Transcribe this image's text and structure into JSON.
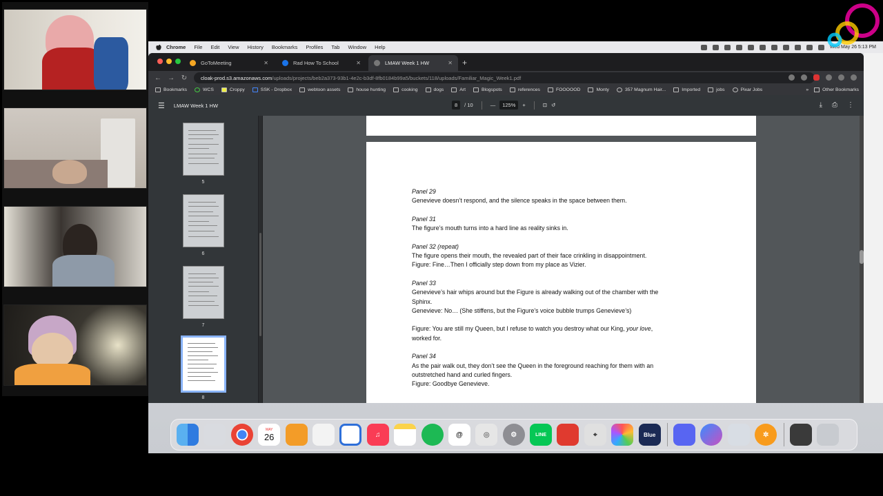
{
  "menubar": {
    "items": [
      "Chrome",
      "File",
      "Edit",
      "View",
      "History",
      "Bookmarks",
      "Profiles",
      "Tab",
      "Window",
      "Help"
    ],
    "clock": "Wed May 26  5:13 PM"
  },
  "tabs": [
    {
      "label": "GoToMeeting",
      "color": "#f5a623"
    },
    {
      "label": "Rad How To School",
      "color": "#1a73e8"
    },
    {
      "label": "LMAW Week 1 HW",
      "color": "#777777"
    }
  ],
  "address": {
    "host": "cloak-prod.s3.amazonaws.com",
    "path": "/uploads/projects/beb2a373-93b1-4e2c-b3df-8fb0184b99a5/buckets/118/uploads/Familiar_Magic_Week1.pdf"
  },
  "bookmarks": [
    "Bookmarks",
    "WCS",
    "Croppy",
    "SSK - Dropbox",
    "webtoon assets",
    "house hunting",
    "cooking",
    "dogs",
    "Art",
    "Blogspots",
    "references",
    "FOOOOOD",
    "Monty",
    "357 Magnum Hair...",
    "Imported",
    "jobs",
    "Pixar Jobs"
  ],
  "other_bookmarks": "Other Bookmarks",
  "pdf": {
    "title": "LMAW Week 1 HW",
    "page": "8",
    "total": "/  10",
    "zoom": "125%",
    "thumb_labels": [
      "5",
      "6",
      "7",
      "8"
    ]
  },
  "script": {
    "p29_h": "Panel 29",
    "p29_1": "Genevieve doesn’t respond, and the silence speaks in the space between them.",
    "p31_h": "Panel 31",
    "p31_1": "The figure’s mouth turns into a hard line as reality sinks in.",
    "p32_h": "Panel 32 (repeat)",
    "p32_1": "The figure opens their mouth, the revealed part of their face crinkling in disappointment.",
    "p32_2": "Figure: Fine…Then I officially step down from my place as Vizier.",
    "p33_h": "Panel 33",
    "p33_1": "Genevieve’s hair whips around but the Figure is already walking out of the chamber with the",
    "p33_2": "Sphinx.",
    "p33_3": "Genevieve: No… (She stiffens, but the Figure’s voice bubble trumps Genevieve’s)",
    "p33_4a": "Figure: You are still my Queen, but I refuse to watch you destroy what our King, ",
    "p33_4b": "your love",
    "p33_4c": ",",
    "p33_5": "worked for.",
    "p34_h": "Panel 34",
    "p34_1": "As the pair walk out, they don’t see the Queen in the foreground reaching for them with an",
    "p34_2": "outstretched hand and curled fingers.",
    "p34_3": "Figure: Goodbye Genevieve."
  },
  "dock": {
    "calendar_month": "MAY",
    "calendar_day": "26",
    "apps": [
      "finder-icon",
      "launchpad-icon",
      "chrome-icon",
      "calendar-icon",
      "books-icon",
      "textedit-icon",
      "clipstudio-icon",
      "music-icon",
      "notes-icon",
      "spotify-icon",
      "threads-icon",
      "swirl-icon",
      "settings-icon",
      "line-icon",
      "acrobat-icon",
      "screenshot-icon",
      "photos-icon",
      "blue-icon",
      "discord-icon",
      "messenger-icon",
      "preview-icon",
      "sunflower-icon"
    ],
    "line_label": "LINE",
    "blue_label": "Blue"
  }
}
